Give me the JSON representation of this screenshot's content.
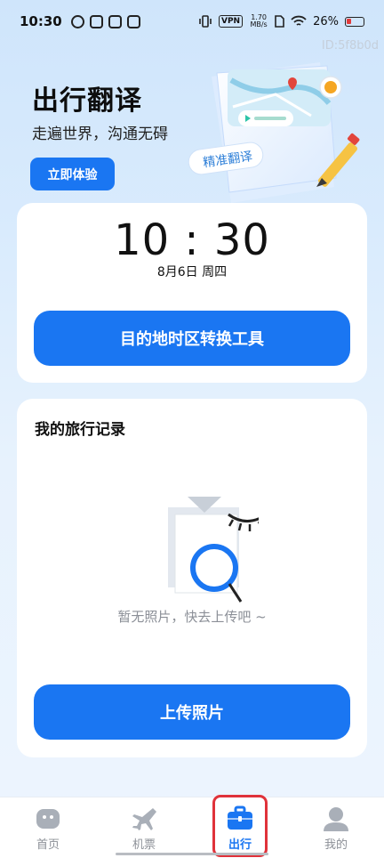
{
  "status_bar": {
    "time": "10:30",
    "left_icons": [
      "leaf-icon",
      "notification-icon",
      "calendar-icon",
      "mail-icon"
    ],
    "vpn": "VPN",
    "net_speed": "1.70 MB/s",
    "battery": "26%"
  },
  "watermark": "ID:5f8b0d",
  "hero": {
    "title": "出行翻译",
    "subtitle": "走遍世界，沟通无碍",
    "button_label": "立即体验",
    "badge_label": "精准翻译"
  },
  "time_card": {
    "clock": "10 : 30",
    "date": "8月6日 周四",
    "button_label": "目的地时区转换工具"
  },
  "records_card": {
    "title": "我的旅行记录",
    "empty_text": "暂无照片，快去上传吧 ~",
    "button_label": "上传照片"
  },
  "tabbar": {
    "tabs": [
      {
        "label": "首页",
        "icon": "home-icon"
      },
      {
        "label": "机票",
        "icon": "airplane-icon"
      },
      {
        "label": "出行",
        "icon": "briefcase-icon"
      },
      {
        "label": "我的",
        "icon": "person-icon"
      }
    ],
    "active_index": 2
  },
  "colors": {
    "accent": "#1a76f2",
    "highlight_box": "#e0323a",
    "inactive_tab": "#8c9097"
  }
}
